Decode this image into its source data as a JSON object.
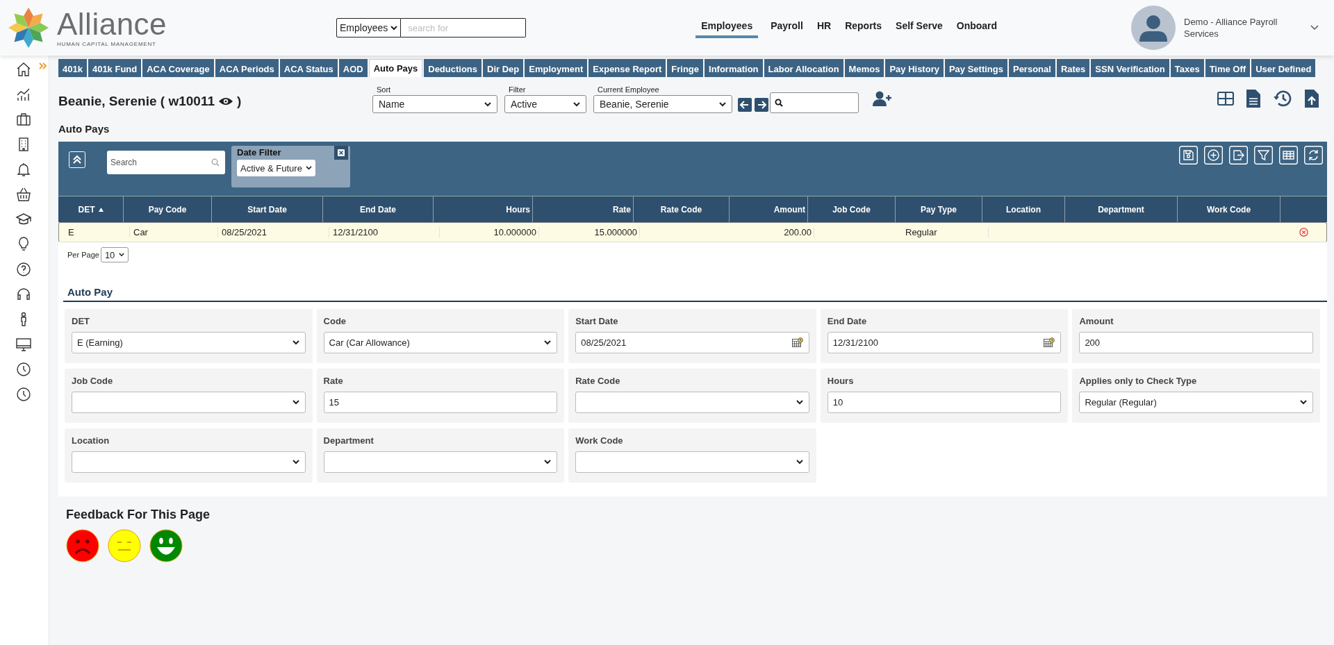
{
  "logo": {
    "name": "Alliance",
    "tagline": "HUMAN CAPITAL MANAGEMENT"
  },
  "global_search": {
    "scope": "Employees",
    "placeholder": "search for"
  },
  "main_nav": [
    {
      "label": "Employees",
      "selected": true
    },
    {
      "label": "Payroll",
      "selected": false
    },
    {
      "label": "HR",
      "selected": false
    },
    {
      "label": "Reports",
      "selected": false
    },
    {
      "label": "Self Serve",
      "selected": false
    },
    {
      "label": "Onboard",
      "selected": false
    }
  ],
  "user": {
    "name": "Demo - Alliance Payroll Services"
  },
  "tabs": [
    {
      "label": "401k",
      "selected": false
    },
    {
      "label": "401k Fund",
      "selected": false
    },
    {
      "label": "ACA Coverage",
      "selected": false
    },
    {
      "label": "ACA Periods",
      "selected": false
    },
    {
      "label": "ACA Status",
      "selected": false
    },
    {
      "label": "AOD",
      "selected": false
    },
    {
      "label": "Auto Pays",
      "selected": true
    },
    {
      "label": "Deductions",
      "selected": false
    },
    {
      "label": "Dir Dep",
      "selected": false
    },
    {
      "label": "Employment",
      "selected": false
    },
    {
      "label": "Expense Report",
      "selected": false
    },
    {
      "label": "Fringe",
      "selected": false
    },
    {
      "label": "Information",
      "selected": false
    },
    {
      "label": "Labor Allocation",
      "selected": false
    },
    {
      "label": "Memos",
      "selected": false
    },
    {
      "label": "Pay History",
      "selected": false
    },
    {
      "label": "Pay Settings",
      "selected": false
    },
    {
      "label": "Personal",
      "selected": false
    },
    {
      "label": "Rates",
      "selected": false
    },
    {
      "label": "SSN Verification",
      "selected": false
    },
    {
      "label": "Taxes",
      "selected": false
    },
    {
      "label": "Time Off",
      "selected": false
    },
    {
      "label": "User Defined",
      "selected": false
    }
  ],
  "employee": {
    "title": "Beanie, Serenie ( w10011",
    "title_end": ")",
    "sort": {
      "label": "Sort",
      "value": "Name"
    },
    "filter": {
      "label": "Filter",
      "value": "Active"
    },
    "current": {
      "label": "Current Employee",
      "value": "Beanie, Serenie"
    }
  },
  "section_title": "Auto Pays",
  "grid": {
    "search_placeholder": "Search",
    "date_filter": {
      "label": "Date Filter",
      "value": "Active & Future"
    },
    "columns": [
      {
        "label": "DET",
        "kind": "text",
        "sorted": true
      },
      {
        "label": "Pay Code",
        "kind": "text",
        "sorted": false
      },
      {
        "label": "Start Date",
        "kind": "text",
        "sorted": false
      },
      {
        "label": "End Date",
        "kind": "text",
        "sorted": false
      },
      {
        "label": "Hours",
        "kind": "number",
        "sorted": false
      },
      {
        "label": "Rate",
        "kind": "number",
        "sorted": false
      },
      {
        "label": "Rate Code",
        "kind": "text",
        "sorted": false
      },
      {
        "label": "Amount",
        "kind": "number",
        "sorted": false
      },
      {
        "label": "Job Code",
        "kind": "text",
        "sorted": false
      },
      {
        "label": "Pay Type",
        "kind": "text",
        "sorted": false
      },
      {
        "label": "Location",
        "kind": "text",
        "sorted": false
      },
      {
        "label": "Department",
        "kind": "text",
        "sorted": false
      },
      {
        "label": "Work Code",
        "kind": "text",
        "sorted": false
      }
    ],
    "rows": [
      {
        "selected": true,
        "cells": [
          "E",
          "Car",
          "08/25/2021",
          "12/31/2100",
          "10.000000",
          "15.000000",
          null,
          "200.00",
          null,
          "Regular",
          null,
          null,
          null
        ]
      }
    ],
    "per_page": {
      "label": "Per Page",
      "value": "10"
    }
  },
  "form": {
    "title": "Auto Pay",
    "fields": [
      {
        "label": "DET",
        "kind": "select",
        "value": "E (Earning)"
      },
      {
        "label": "Code",
        "kind": "select",
        "value": "Car (Car Allowance)"
      },
      {
        "label": "Start Date",
        "kind": "date",
        "value": "08/25/2021"
      },
      {
        "label": "End Date",
        "kind": "date",
        "value": "12/31/2100"
      },
      {
        "label": "Amount",
        "kind": "text",
        "value": "200"
      },
      {
        "label": "Job Code",
        "kind": "select"
      },
      {
        "label": "Rate",
        "kind": "text",
        "value": "15"
      },
      {
        "label": "Rate Code",
        "kind": "select"
      },
      {
        "label": "Hours",
        "kind": "text",
        "value": "10"
      },
      {
        "label": "Applies only to Check Type",
        "kind": "select",
        "value": "Regular (Regular)"
      },
      {
        "label": "Location",
        "kind": "select"
      },
      {
        "label": "Department",
        "kind": "select"
      },
      {
        "label": "Work Code",
        "kind": "select"
      }
    ]
  },
  "feedback": {
    "title": "Feedback For This Page"
  }
}
